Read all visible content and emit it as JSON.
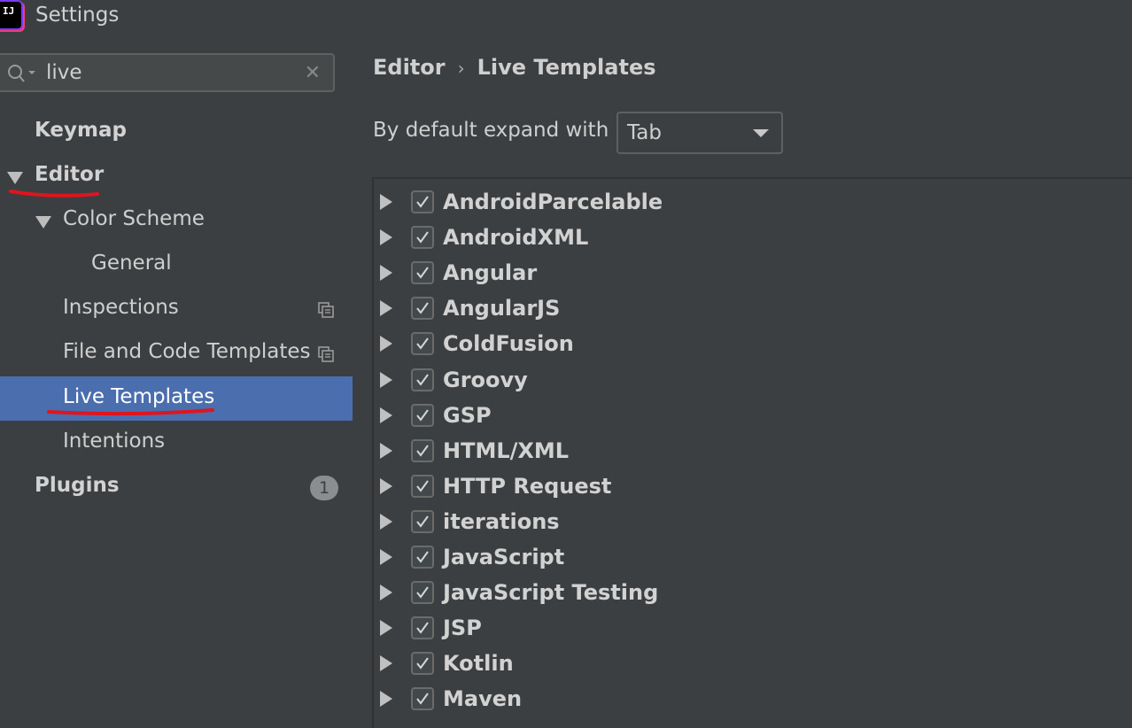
{
  "window": {
    "title": "Settings",
    "logo_text": "IJ"
  },
  "search": {
    "value": "live"
  },
  "sidebar": {
    "items": [
      {
        "label": "Keymap"
      },
      {
        "label": "Editor"
      },
      {
        "label": "Color Scheme"
      },
      {
        "label": "General"
      },
      {
        "label": "Inspections"
      },
      {
        "label": "File and Code Templates"
      },
      {
        "label": "Live Templates"
      },
      {
        "label": "Intentions"
      },
      {
        "label": "Plugins",
        "badge": "1"
      }
    ]
  },
  "main": {
    "breadcrumb": [
      "Editor",
      "Live Templates"
    ],
    "breadcrumb_separator": "›",
    "expand_label": "By default expand with",
    "expand_value": "Tab",
    "templates": [
      {
        "name": "AndroidParcelable",
        "checked": true
      },
      {
        "name": "AndroidXML",
        "checked": true
      },
      {
        "name": "Angular",
        "checked": true
      },
      {
        "name": "AngularJS",
        "checked": true
      },
      {
        "name": "ColdFusion",
        "checked": true
      },
      {
        "name": "Groovy",
        "checked": true
      },
      {
        "name": "GSP",
        "checked": true
      },
      {
        "name": "HTML/XML",
        "checked": true
      },
      {
        "name": "HTTP Request",
        "checked": true
      },
      {
        "name": "iterations",
        "checked": true
      },
      {
        "name": "JavaScript",
        "checked": true
      },
      {
        "name": "JavaScript Testing",
        "checked": true
      },
      {
        "name": "JSP",
        "checked": true
      },
      {
        "name": "Kotlin",
        "checked": true
      },
      {
        "name": "Maven",
        "checked": true
      }
    ]
  },
  "colors": {
    "background": "#3c3f41",
    "selection": "#4b6eaf",
    "annotation": "#e0141e"
  }
}
